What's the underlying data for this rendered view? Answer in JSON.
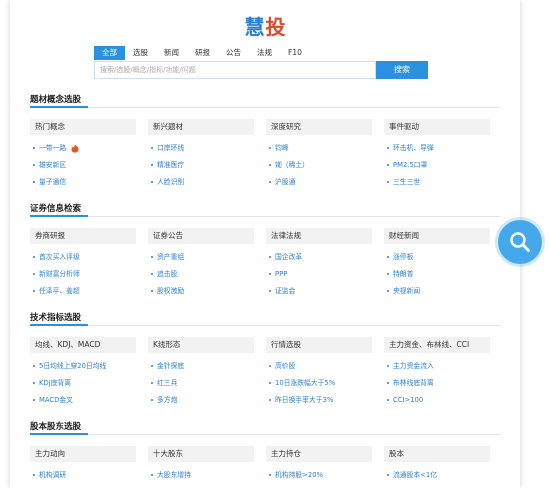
{
  "logo": {
    "glyph1": "慧",
    "glyph2": "投"
  },
  "search": {
    "tabs": [
      "全部",
      "选股",
      "新闻",
      "研报",
      "公告",
      "法规",
      "F10"
    ],
    "active_tab": 0,
    "placeholder": "搜索/选股/概念/指标/功能/问题",
    "button_label": "搜索"
  },
  "sections": [
    {
      "title": "题材概念选股",
      "columns": [
        {
          "head": "热门概念",
          "items": [
            "一带一路",
            "雄安新区",
            "量子通信"
          ],
          "hot_first": true
        },
        {
          "head": "新兴题材",
          "items": [
            "口岸环线",
            "精准医疗",
            "人脸识别"
          ]
        },
        {
          "head": "深度研究",
          "items": [
            "钧峰",
            "铷（稀土）",
            "沪股通"
          ]
        },
        {
          "head": "事件驱动",
          "items": [
            "环击机、导弹",
            "PM2.5口罩",
            "三生三世"
          ]
        }
      ]
    },
    {
      "title": "证券信息检索",
      "columns": [
        {
          "head": "券商研报",
          "items": [
            "首次买入评级",
            "新财富分析师",
            "任泽平、姜超"
          ]
        },
        {
          "head": "证券公告",
          "items": [
            "资产重组",
            "追击股",
            "股权激励"
          ]
        },
        {
          "head": "法律法规",
          "items": [
            "国企改革",
            "PPP",
            "证监会"
          ]
        },
        {
          "head": "财经新闻",
          "items": [
            "涨停板",
            "特朗普",
            "央视新闻"
          ]
        }
      ]
    },
    {
      "title": "技术指标选股",
      "columns": [
        {
          "head": "均线、KDJ、MACD",
          "items": [
            "5日均线上穿20日均线",
            "KDJ底背离",
            "MACD金叉"
          ]
        },
        {
          "head": "K线形态",
          "items": [
            "金针探底",
            "红三兵",
            "多方炮"
          ]
        },
        {
          "head": "行情选股",
          "items": [
            "高价股",
            "10日涨跌幅大于5%",
            "昨日换手率大于3%"
          ]
        },
        {
          "head": "主力资金、布林线、CCI",
          "items": [
            "主力资金流入",
            "布林线底背离",
            "CCI>100"
          ]
        }
      ]
    },
    {
      "title": "股本股东选股",
      "columns": [
        {
          "head": "主力动向",
          "items": [
            "机构调研"
          ]
        },
        {
          "head": "十大股东",
          "items": [
            "大股东增持"
          ]
        },
        {
          "head": "主力持仓",
          "items": [
            "机构持股>20%"
          ]
        },
        {
          "head": "股本",
          "items": [
            "流通股本<1亿"
          ]
        }
      ]
    }
  ],
  "colors": {
    "accent": "#2a91e0",
    "link": "#2a7fd4",
    "hot": "#e8541c",
    "float_button": "#45a8ea"
  },
  "icons": {
    "hot": "flame-badge-icon",
    "float": "magnifier-icon"
  }
}
